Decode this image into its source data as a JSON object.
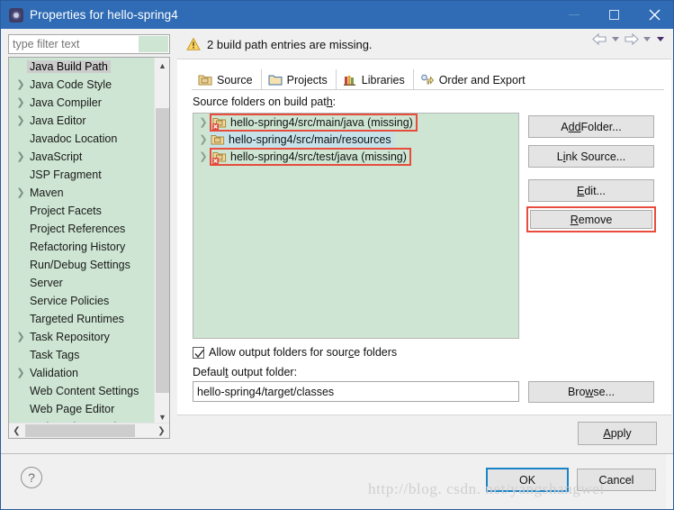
{
  "window": {
    "title": "Properties for hello-spring4",
    "icon": "properties-gear-icon",
    "minimize_label": "–",
    "maximize_label": "□",
    "close_label": "✕"
  },
  "filter": {
    "placeholder": "type filter text",
    "value": ""
  },
  "sidebar": {
    "items": [
      {
        "label": "Java Build Path",
        "expandable": false,
        "selected": true
      },
      {
        "label": "Java Code Style",
        "expandable": true,
        "selected": false
      },
      {
        "label": "Java Compiler",
        "expandable": true,
        "selected": false
      },
      {
        "label": "Java Editor",
        "expandable": true,
        "selected": false
      },
      {
        "label": "Javadoc Location",
        "expandable": false,
        "selected": false
      },
      {
        "label": "JavaScript",
        "expandable": true,
        "selected": false
      },
      {
        "label": "JSP Fragment",
        "expandable": false,
        "selected": false
      },
      {
        "label": "Maven",
        "expandable": true,
        "selected": false
      },
      {
        "label": "Project Facets",
        "expandable": false,
        "selected": false
      },
      {
        "label": "Project References",
        "expandable": false,
        "selected": false
      },
      {
        "label": "Refactoring History",
        "expandable": false,
        "selected": false
      },
      {
        "label": "Run/Debug Settings",
        "expandable": false,
        "selected": false
      },
      {
        "label": "Server",
        "expandable": false,
        "selected": false
      },
      {
        "label": "Service Policies",
        "expandable": false,
        "selected": false
      },
      {
        "label": "Targeted Runtimes",
        "expandable": false,
        "selected": false
      },
      {
        "label": "Task Repository",
        "expandable": true,
        "selected": false
      },
      {
        "label": "Task Tags",
        "expandable": false,
        "selected": false
      },
      {
        "label": "Validation",
        "expandable": true,
        "selected": false
      },
      {
        "label": "Web Content Settings",
        "expandable": false,
        "selected": false
      },
      {
        "label": "Web Page Editor",
        "expandable": false,
        "selected": false
      },
      {
        "label": "Web Project Settings",
        "expandable": false,
        "selected": false
      }
    ]
  },
  "header": {
    "warning_text": "2 build path entries are missing.",
    "warning_icon": "warning-triangle-icon",
    "nav_back_icon": "back-arrow-icon",
    "nav_forward_icon": "forward-arrow-icon",
    "menu_caret_icon": "chevron-down-icon"
  },
  "tabs": [
    {
      "label": "Source",
      "icon": "source-folder-icon",
      "active": true
    },
    {
      "label": "Projects",
      "icon": "project-folder-icon",
      "active": false
    },
    {
      "label": "Libraries",
      "icon": "libraries-books-icon",
      "active": false
    },
    {
      "label": "Order and Export",
      "icon": "order-export-icon",
      "active": false
    }
  ],
  "source_section": {
    "label_prefix": "Source folders on build pat",
    "label_mnemonic": "h",
    "label_suffix": ":",
    "entries": [
      {
        "text": "hello-spring4/src/main/java (missing)",
        "missing": true,
        "highlighted": false,
        "error_outline": true
      },
      {
        "text": "hello-spring4/src/main/resources",
        "missing": false,
        "highlighted": true,
        "error_outline": false
      },
      {
        "text": "hello-spring4/src/test/java (missing)",
        "missing": true,
        "highlighted": false,
        "error_outline": true
      }
    ],
    "buttons": {
      "add_folder": {
        "pre": "A",
        "mnemonic": "dd",
        "post": " Folder..."
      },
      "link_source": {
        "pre": "L",
        "mnemonic": "i",
        "post": "nk Source..."
      },
      "edit": {
        "pre": "",
        "mnemonic": "E",
        "post": "dit..."
      },
      "remove": {
        "pre": "",
        "mnemonic": "R",
        "post": "emove",
        "highlighted": true
      }
    }
  },
  "allow_output": {
    "checked": true,
    "pre": "Allow output folders for sour",
    "mnemonic": "c",
    "post": "e folders"
  },
  "default_output": {
    "label_pre": "Defaul",
    "label_mnemonic": "t",
    "label_post": " output folder:",
    "value": "hello-spring4/target/classes",
    "browse": {
      "pre": "Bro",
      "mnemonic": "w",
      "post": "se..."
    }
  },
  "footer": {
    "help_label": "?",
    "apply": {
      "pre": "",
      "mnemonic": "A",
      "post": "pply"
    },
    "ok": "OK",
    "cancel": "Cancel"
  },
  "watermark": "http://blog. csdn. net/yangshangwei",
  "colors": {
    "titlebar": "#2f6cb5",
    "list_green": "#cde5d2",
    "error_red": "#e74c3c",
    "selected_blue": "#c5e2ea",
    "focus_blue": "#1b84c7"
  }
}
